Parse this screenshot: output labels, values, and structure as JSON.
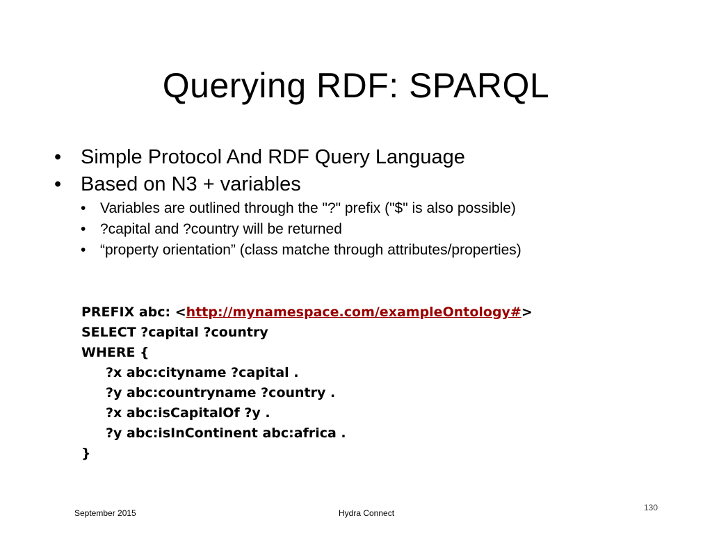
{
  "slide": {
    "title": "Querying RDF: SPARQL",
    "bullets": [
      {
        "text": "Simple Protocol And RDF Query Language"
      },
      {
        "text": "Based on N3 + variables"
      }
    ],
    "sub_bullets": [
      {
        "text": "Variables are outlined through the \"?\" prefix (\"$\" is also possible)"
      },
      {
        "text": "?capital and ?country will be returned"
      },
      {
        "text": "“property orientation” (class matche through attributes/properties)"
      }
    ],
    "code": {
      "prefix_label": "PREFIX abc: <",
      "prefix_link": "http://mynamespace.com/exampleOntology#",
      "prefix_close": ">",
      "select_line": "SELECT ?capital ?country",
      "where_open": "WHERE {",
      "triples": [
        "?x abc:cityname ?capital .",
        "?y abc:countryname ?country .",
        "?x abc:isCapitalOf ?y .",
        "?y abc:isInContinent abc:africa ."
      ],
      "where_close": "}"
    },
    "link_color": "#990000"
  },
  "footer": {
    "date": "September 2015",
    "event": "Hydra Connect",
    "page_number": "130"
  }
}
